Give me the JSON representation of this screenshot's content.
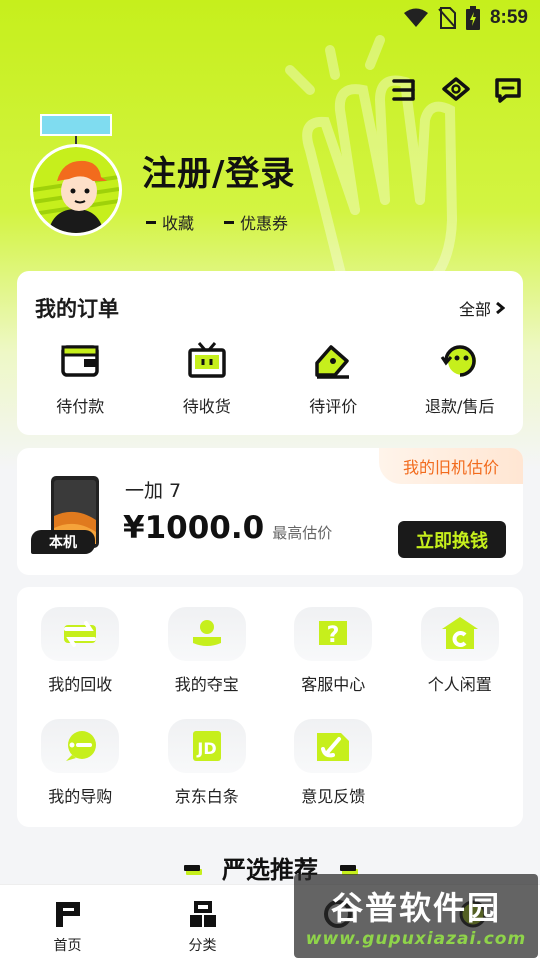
{
  "status_bar": {
    "time": "8:59"
  },
  "profile": {
    "login_title": "注册/登录",
    "favorites_label": "收藏",
    "coupons_label": "优惠券"
  },
  "orders": {
    "title": "我的订单",
    "all_label": "全部",
    "items": [
      {
        "label": "待付款",
        "icon": "wallet-icon"
      },
      {
        "label": "待收货",
        "icon": "tv-box-icon"
      },
      {
        "label": "待评价",
        "icon": "pen-review-icon"
      },
      {
        "label": "退款/售后",
        "icon": "refund-icon"
      }
    ]
  },
  "trade_in": {
    "ribbon": "我的旧机估价",
    "device_tag": "本机",
    "device_name": "一加 7",
    "price": "¥1000.0",
    "price_note": "最高估价",
    "button": "立即换钱"
  },
  "services": [
    {
      "label": "我的回收",
      "icon": "recycle-icon"
    },
    {
      "label": "我的夺宝",
      "icon": "treasure-icon"
    },
    {
      "label": "客服中心",
      "icon": "help-icon"
    },
    {
      "label": "个人闲置",
      "icon": "idle-icon"
    },
    {
      "label": "我的导购",
      "icon": "chat-guide-icon"
    },
    {
      "label": "京东白条",
      "icon": "jd-icon"
    },
    {
      "label": "意见反馈",
      "icon": "feedback-icon"
    }
  ],
  "recommend_title": "严选推荐",
  "bottom_nav": [
    {
      "label": "首页",
      "icon": "home-icon"
    },
    {
      "label": "分类",
      "icon": "category-icon"
    },
    {
      "label": "",
      "icon": "sell-icon"
    },
    {
      "label": "",
      "icon": "mine-icon"
    }
  ],
  "watermark": {
    "title": "谷普软件园",
    "url": "www.gupuxiazai.com"
  },
  "colors": {
    "accent": "#c6ef1c",
    "dark": "#1a1a1a",
    "orange": "#f26b1d"
  }
}
